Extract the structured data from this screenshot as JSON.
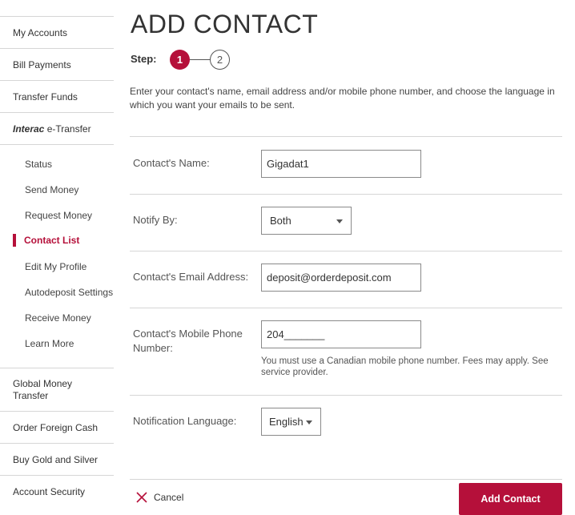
{
  "sidebar": {
    "items_top": [
      "My Accounts",
      "Bill Payments",
      "Transfer Funds"
    ],
    "interac_prefix": "Interac",
    "interac_suffix": " e-Transfer",
    "sub_items": [
      "Status",
      "Send Money",
      "Request Money",
      "Contact List",
      "Edit My Profile",
      "Autodeposit Settings",
      "Receive Money",
      "Learn More"
    ],
    "active_sub_item": "Contact List",
    "items_bottom": [
      "Global Money Transfer",
      "Order Foreign Cash",
      "Buy Gold and Silver",
      "Account Security"
    ]
  },
  "page": {
    "title": "ADD CONTACT",
    "step_label": "Step:",
    "step_current": "1",
    "step_next": "2",
    "intro": "Enter your contact's name, email address and/or mobile phone number, and choose the language in which you want your emails to be sent."
  },
  "form": {
    "name_label": "Contact's Name:",
    "name_value": "Gigadat1",
    "notify_label": "Notify By:",
    "notify_value": "Both",
    "email_label": "Contact's Email Address:",
    "email_value": "deposit@orderdeposit.com",
    "phone_label": "Contact's Mobile Phone Number:",
    "phone_value": "204_______",
    "phone_note": "You must use a Canadian mobile phone number. Fees may apply. See service provider.",
    "language_label": "Notification Language:",
    "language_value": "English"
  },
  "actions": {
    "cancel_label": "Cancel",
    "add_label": "Add Contact"
  },
  "colors": {
    "accent": "#b5103a",
    "divider": "#d6d6d6"
  }
}
